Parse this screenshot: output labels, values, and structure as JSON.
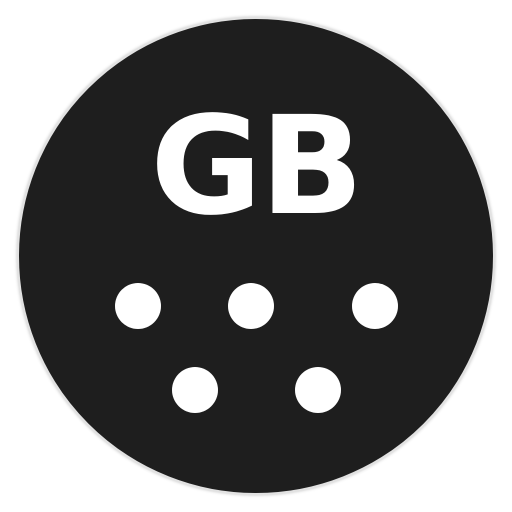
{
  "icon": {
    "text": "GB",
    "background_color": "#1e1e1e",
    "foreground_color": "#ffffff",
    "dot_count": 5
  }
}
